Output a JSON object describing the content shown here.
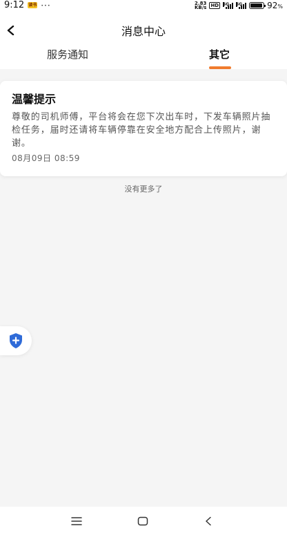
{
  "status_bar": {
    "time": "9:12",
    "badge": "读书",
    "dots": "···",
    "speed_top": "2.83",
    "speed_bottom": "KB/s",
    "hd": "HD",
    "net1": "5G",
    "net2": "5G",
    "battery_pct": "92",
    "battery_unit": "%"
  },
  "header": {
    "back_icon": "chevron-left-icon",
    "title": "消息中心"
  },
  "tabs": [
    {
      "label": "服务通知",
      "active": false
    },
    {
      "label": "其它",
      "active": true
    }
  ],
  "colors": {
    "accent": "#f07b2d",
    "shield": "#2f6bd8",
    "background": "#f5f5f5"
  },
  "message": {
    "title": "温馨提示",
    "body": "尊敬的司机师傅，平台将会在您下次出车时，下发车辆照片抽检任务，届时还请将车辆停靠在安全地方配合上传照片，谢谢。",
    "time": "08月09日 08:59"
  },
  "footer_text": "没有更多了",
  "float_button": {
    "icon": "shield-plus-icon"
  },
  "nav": {
    "menu_icon": "menu-icon",
    "home_icon": "home-square-icon",
    "back_icon": "back-triangle-icon"
  }
}
